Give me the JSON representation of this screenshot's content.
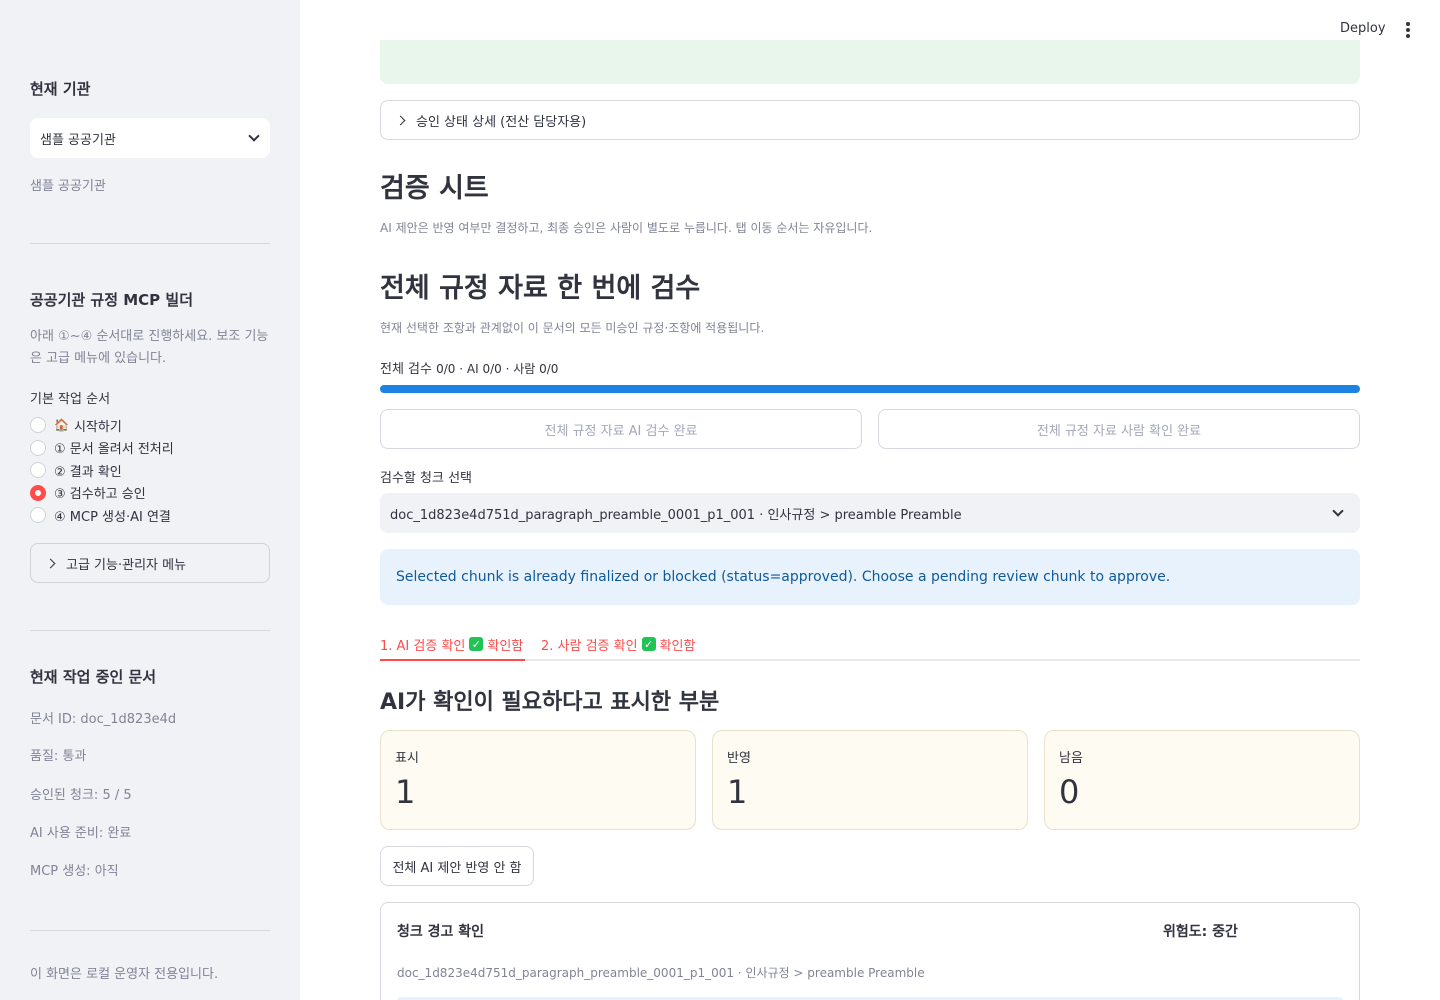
{
  "sidebar": {
    "org_heading": "현재 기관",
    "org_select_value": "샘플 공공기관",
    "org_caption": "샘플 공공기관",
    "builder_heading": "공공기관 규정 MCP 빌더",
    "builder_caption": "아래 ①~④ 순서대로 진행하세요. 보조 기능은 고급 메뉴에 있습니다.",
    "steps_label": "기본 작업 순서",
    "steps": [
      {
        "icon": "🏠",
        "label": "시작하기",
        "selected": false
      },
      {
        "label": "① 문서 올려서 전처리",
        "selected": false
      },
      {
        "label": "② 결과 확인",
        "selected": false
      },
      {
        "label": "③ 검수하고 승인",
        "selected": true
      },
      {
        "label": "④ MCP 생성·AI 연결",
        "selected": false
      }
    ],
    "advanced_menu": "고급 기능·관리자 메뉴",
    "doc_heading": "현재 작업 중인 문서",
    "doc_id": "문서 ID: doc_1d823e4d",
    "quality": "품질: 통과",
    "approved_chunks": "승인된 청크: 5 / 5",
    "ai_ready": "AI 사용 준비: 완료",
    "mcp_status": "MCP 생성: 아직",
    "local_notice": "이 화면은 로컬 운영자 전용입니다."
  },
  "header": {
    "deploy": "Deploy"
  },
  "main": {
    "approval_detail": "승인 상태 상세 (전산 담당자용)",
    "sheet_title": "검증 시트",
    "sheet_caption": "AI 제안은 반영 여부만 결정하고, 최종 승인은 사람이 별도로 누릅니다. 탭 이동 순서는 자유입니다.",
    "bulk_title": "전체 규정 자료 한 번에 검수",
    "bulk_caption": "현재 선택한 조항과 관계없이 이 문서의 모든 미승인 규정·조항에 적용됩니다.",
    "progress_label_prefix": "전체 검수",
    "progress_label_values": "0/0 · AI 0/0 · 사람 0/0",
    "progress_fraction": 1.0,
    "btn_ai_done": "전체 규정 자료 AI 검수 완료",
    "btn_human_done": "전체 규정 자료 사람 확인 완료",
    "chunk_select_label": "검수할 청크 선택",
    "chunk_select_value": "doc_1d823e4d751d_paragraph_preamble_0001_p1_001 · 인사규정 > preamble Preamble",
    "info_message": "Selected chunk is already finalized or blocked (status=approved). Choose a pending review chunk to approve.",
    "tabs": [
      {
        "label": "1. AI 검증 확인",
        "status": "확인함"
      },
      {
        "label": "2. 사람 검증 확인",
        "status": "확인함"
      }
    ],
    "flag_title": "AI가 확인이 필요하다고 표시한 부분",
    "metrics": [
      {
        "label": "표시",
        "value": "1"
      },
      {
        "label": "반영",
        "value": "1"
      },
      {
        "label": "남음",
        "value": "0"
      }
    ],
    "reject_all_button": "전체 AI 제안 반영 안 함",
    "card": {
      "title": "청크 경고 확인",
      "risk": "위험도: 중간",
      "chunk_ref": "doc_1d823e4d751d_paragraph_preamble_0001_p1_001 · 인사규정 > preamble Preamble"
    }
  },
  "colors": {
    "accent": "#ff4b4b",
    "progress": "#1c83e1",
    "success": "#21c354",
    "info_bg": "#e8f2fd"
  }
}
